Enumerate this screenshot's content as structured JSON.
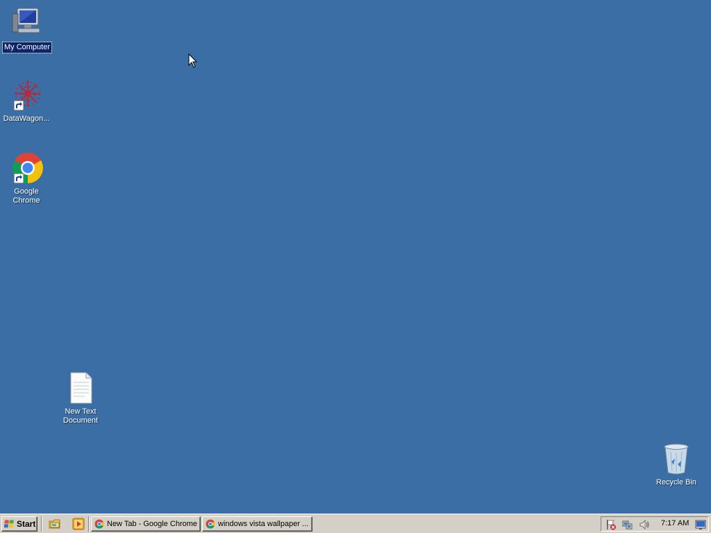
{
  "desktop": {
    "background_color": "#3a6ea5",
    "icons": [
      {
        "label": "My Computer",
        "icon": "my-computer-icon",
        "selected": true
      },
      {
        "label": "DataWagon...",
        "icon": "datawagon-icon",
        "shortcut": true
      },
      {
        "label": "Google Chrome",
        "icon": "chrome-icon",
        "shortcut": true
      },
      {
        "label_line1": "New Text",
        "label_line2": "Document",
        "icon": "text-document-icon"
      },
      {
        "label": "Recycle Bin",
        "icon": "recycle-bin-icon"
      }
    ]
  },
  "taskbar": {
    "start_label": "Start",
    "quick_launch": [
      "explorer-icon",
      "media-player-icon"
    ],
    "tasks": [
      {
        "label": "New Tab - Google Chrome",
        "icon": "chrome-icon"
      },
      {
        "label": "windows vista wallpaper ...",
        "icon": "chrome-icon"
      }
    ],
    "tray": {
      "icons": [
        "security-alert-icon",
        "network-icon",
        "volume-icon"
      ],
      "clock": "7:17 AM",
      "extra_icon": "show-desktop-icon"
    }
  }
}
